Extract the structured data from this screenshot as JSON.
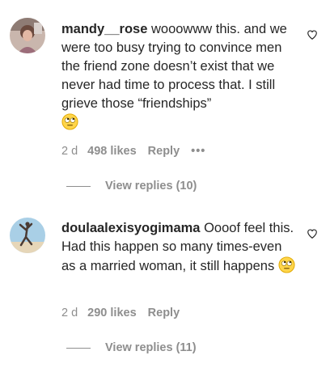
{
  "comments": [
    {
      "username": "mandy__rose",
      "text": " wooowww this. and we were too busy trying to convince men the friend zone doesn’t exist that we never had time to process that. I still grieve those “friendships”",
      "emoji": "face-with-rolling-eyes",
      "time": "2 d",
      "likes": "498 likes",
      "reply_label": "Reply",
      "more_label": "•••",
      "view_replies": "View replies (10)"
    },
    {
      "username": "doulaalexisyogimama",
      "text": " Oooof feel this. Had this happen so many times-even as a married woman, it still happens",
      "emoji": "face-with-rolling-eyes",
      "time": "2 d",
      "likes": "290 likes",
      "reply_label": "Reply",
      "view_replies": "View replies (11)"
    }
  ],
  "colors": {
    "text": "#262626",
    "secondary": "#8e8e8e",
    "emoji_yellow": "#ffd54a"
  }
}
